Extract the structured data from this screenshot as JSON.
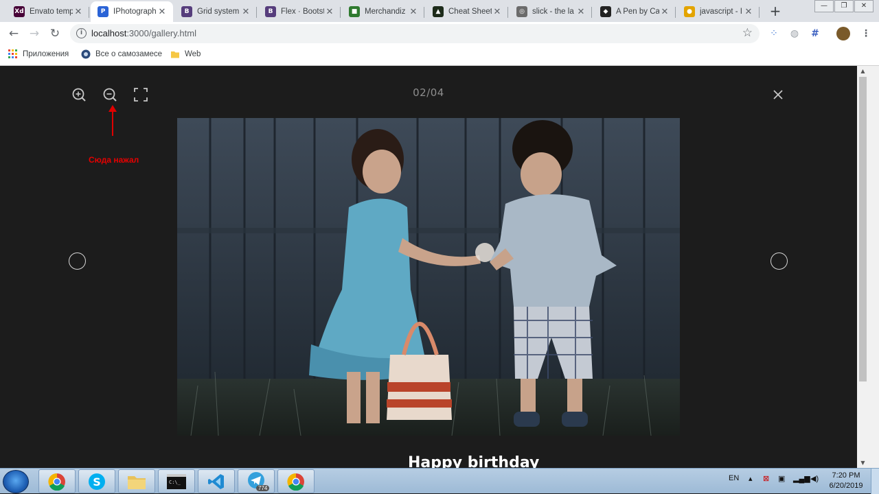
{
  "tabs": [
    {
      "title": "Envato temp",
      "icon": "adobe-xd-icon",
      "color": "#470137",
      "glyph": "Xd",
      "active": false
    },
    {
      "title": "IPhotograph",
      "icon": "iphotography-icon",
      "color": "#2a63d6",
      "glyph": "P",
      "active": true
    },
    {
      "title": "Grid system",
      "icon": "bootstrap-icon",
      "color": "#563d7c",
      "glyph": "B",
      "active": false
    },
    {
      "title": "Flex · Bootst",
      "icon": "bootstrap-icon",
      "color": "#563d7c",
      "glyph": "B",
      "active": false
    },
    {
      "title": "Merchandiz",
      "icon": "merchandise-icon",
      "color": "#2f7a2f",
      "glyph": "■",
      "active": false
    },
    {
      "title": "Cheat Sheet",
      "icon": "cheatsheet-icon",
      "color": "#1d2b1a",
      "glyph": "▲",
      "active": false
    },
    {
      "title": "slick - the la",
      "icon": "globe-icon",
      "color": "#6b6b6b",
      "glyph": "◎",
      "active": false
    },
    {
      "title": "A Pen by Ca",
      "icon": "codepen-icon",
      "color": "#222222",
      "glyph": "◆",
      "active": false
    },
    {
      "title": "javascript - I",
      "icon": "sunglasses-icon",
      "color": "#e3a400",
      "glyph": "●",
      "active": false
    }
  ],
  "address": {
    "host": "localhost",
    "path": ":3000/gallery.html"
  },
  "bookmarks": [
    {
      "label": "Приложения",
      "icon": "apps-grid-icon"
    },
    {
      "label": "Все о самозамесе",
      "icon": "site-icon"
    },
    {
      "label": "Web",
      "icon": "folder-icon"
    }
  ],
  "lightbox": {
    "counter": "02/04",
    "caption": "Happy birthday",
    "annotation": "Сюда нажал"
  },
  "taskbar": {
    "apps": [
      "chrome-icon",
      "skype-icon",
      "explorer-icon",
      "terminal-icon",
      "vscode-icon",
      "telegram-icon",
      "chrome-icon"
    ],
    "telegram_badge": "774",
    "lang": "EN",
    "time": "7:20 PM",
    "date": "6/20/2019"
  }
}
